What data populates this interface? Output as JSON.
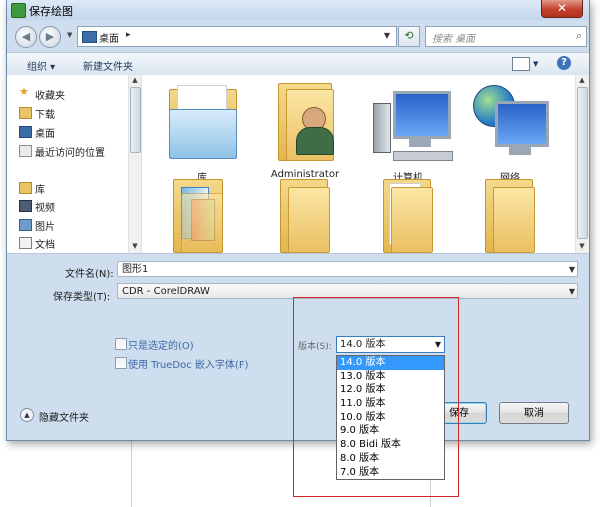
{
  "window": {
    "title": "保存绘图",
    "close_symbol": "✕"
  },
  "address": {
    "location": "桌面",
    "separator": "▸"
  },
  "search": {
    "placeholder": "搜索 桌面"
  },
  "toolbar": {
    "organize": "组织 ▾",
    "new_folder": "新建文件夹"
  },
  "sidebar": {
    "items": [
      {
        "label": "收藏夹",
        "icon": "star-icon"
      },
      {
        "label": "下载",
        "icon": "download-folder-icon"
      },
      {
        "label": "桌面",
        "icon": "desktop-icon"
      },
      {
        "label": "最近访问的位置",
        "icon": "recent-places-icon"
      },
      {
        "label": "库",
        "icon": "libraries-icon"
      },
      {
        "label": "视频",
        "icon": "videos-icon"
      },
      {
        "label": "图片",
        "icon": "pictures-icon"
      },
      {
        "label": "文档",
        "icon": "documents-icon"
      }
    ]
  },
  "files": {
    "items": [
      {
        "label": "库",
        "icon": "libraries-folder-icon"
      },
      {
        "label": "Administrator",
        "icon": "user-folder-icon"
      },
      {
        "label": "计算机",
        "icon": "computer-icon"
      },
      {
        "label": "网络",
        "icon": "network-icon"
      },
      {
        "label": "",
        "icon": "folder-icon"
      },
      {
        "label": "",
        "icon": "folder-icon"
      },
      {
        "label": "",
        "icon": "folder-icon"
      },
      {
        "label": "",
        "icon": "folder-icon"
      }
    ]
  },
  "form": {
    "filename_label": "文件名(N):",
    "filename_value": "图形1",
    "filetype_label": "保存类型(T):",
    "filetype_value": "CDR - CorelDRAW",
    "selected_only": "只是选定的(O)",
    "truedoc": "使用 TrueDoc 嵌入字体(F)",
    "version_label": "版本(S):",
    "version_value": "14.0 版本",
    "version_options": [
      "14.0 版本",
      "13.0 版本",
      "12.0 版本",
      "11.0 版本",
      "10.0 版本",
      "9.0 版本",
      "8.0 Bidi 版本",
      "8.0 版本",
      "7.0 版本"
    ]
  },
  "buttons": {
    "save": "保存",
    "cancel": "取消",
    "hide_folders": "隐藏文件夹"
  },
  "colors": {
    "dialog_bg": "#cfdeee",
    "selection": "#3399ff",
    "highlight_box": "#d32828"
  }
}
